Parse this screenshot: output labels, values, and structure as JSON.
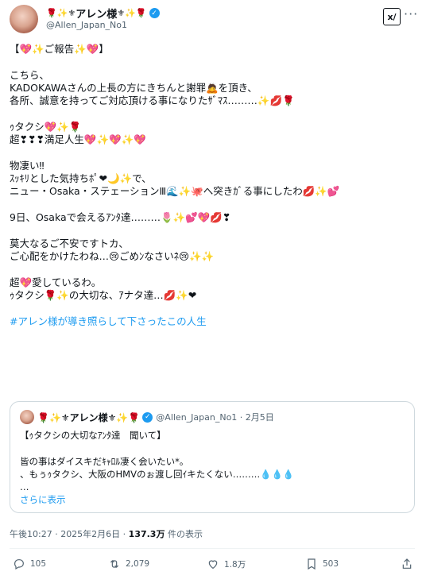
{
  "post": {
    "display_name": "アレン様",
    "emoji_prefix": "🌹✨⚜",
    "emoji_suffix": "⚜✨🌹",
    "handle": "@Allen_Japan_No1",
    "grok_label": "x/",
    "more_label": "···",
    "lines": [
      "【💖✨ご報告✨💖】",
      "",
      "こちら、",
      "KADOKAWAさんの上長の方にきちんと謝罪🙇を頂き、",
      "各所、誠意を持ってご対応頂ける事になりたｻﾞﾏｽ………✨💋🌹",
      "",
      "ｩタクシ💖✨🌹",
      "超❣❣❣満足人生💖✨💖✨💖",
      "",
      "物凄い‼",
      "ｽｯｷﾘとした気持ちﾎﾟ❤🌙✨で、",
      "ニュー・Osaka・ステェーションⅢ🌊✨🐙へ突きｶﾞる事にしたわ💋✨💕",
      "",
      "9日、Osakaで会えるｱﾝﾀ達………🌷✨💕💖💋❣",
      "",
      "莫大なるご不安ですトカ、",
      "ご心配をかけたわね…😢ごめﾝなさいﾈ😢✨✨",
      "",
      "超💖愛しているわ。",
      "ｩタクシ🌹✨の大切な、ｱナタ達…💋✨❤",
      ""
    ],
    "hashtag": "#アレン様が導き照らして下さったこの人生"
  },
  "quote": {
    "display_name": "🌹✨⚜アレン様⚜✨🌹",
    "handle_date": "@Allen_Japan_No1 · 2月5日",
    "lines": [
      "【ｩタクシの大切なｱﾝﾀ達　聞いて】",
      "",
      "皆の事はダイスキだｷｬﾛﾙ凄く会いたい*｡",
      "、もぅｩタクシ、大阪のHMVのぉ渡し回ｲキたくない………💧💧💧",
      "…"
    ],
    "show_more": "さらに表示"
  },
  "meta": {
    "datetime": "午後10:27 · 2025年2月6日 · ",
    "views": "137.3万",
    "views_label": " 件の表示"
  },
  "actions": {
    "replies": "105",
    "reposts": "2,079",
    "likes": "1.8万",
    "bookmarks": "503"
  },
  "colors": {
    "accent": "#1d9bf0",
    "muted": "#536471",
    "text": "#0f1419"
  }
}
